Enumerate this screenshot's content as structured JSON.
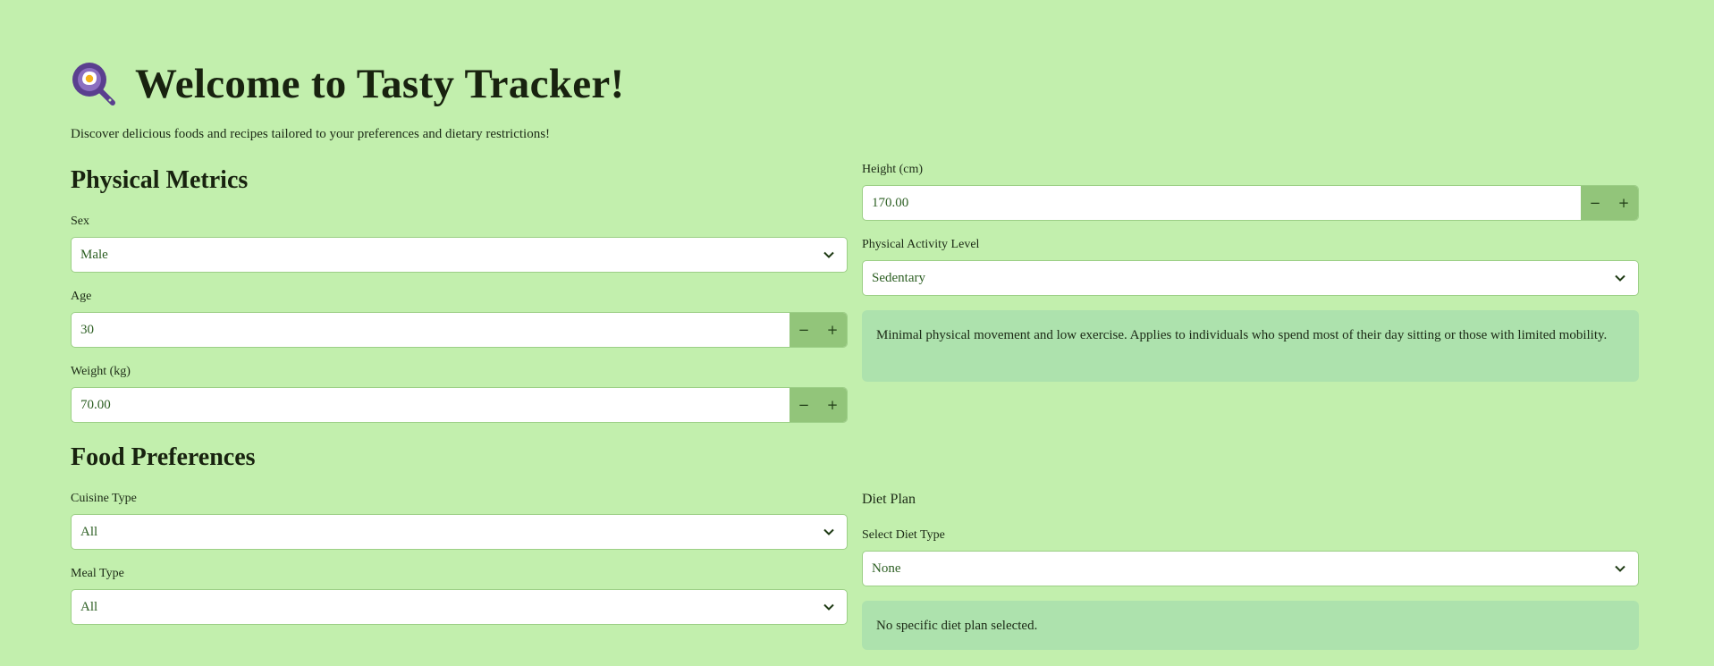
{
  "header": {
    "title": "Welcome to Tasty Tracker!",
    "subtitle": "Discover delicious foods and recipes tailored to your preferences and dietary restrictions!",
    "logo_icon": "frying-pan-egg-icon"
  },
  "physical_metrics": {
    "heading": "Physical Metrics",
    "sex": {
      "label": "Sex",
      "value": "Male"
    },
    "age": {
      "label": "Age",
      "value": "30"
    },
    "weight": {
      "label": "Weight (kg)",
      "value": "70.00"
    },
    "height": {
      "label": "Height (cm)",
      "value": "170.00"
    },
    "activity": {
      "label": "Physical Activity Level",
      "value": "Sedentary",
      "description": "Minimal physical movement and low exercise. Applies to individuals who spend most of their day sitting or those with limited mobility."
    }
  },
  "food_preferences": {
    "heading": "Food Preferences",
    "cuisine": {
      "label": "Cuisine Type",
      "value": "All"
    },
    "meal": {
      "label": "Meal Type",
      "value": "All"
    },
    "diet_plan": {
      "heading": "Diet Plan",
      "label": "Select Diet Type",
      "value": "None",
      "description": "No specific diet plan selected."
    }
  },
  "stepper": {
    "minus": "−",
    "plus": "+"
  },
  "colors": {
    "background": "#c2efad",
    "stepper_button": "#92c57a",
    "info_box": "#ade2ad",
    "logo": "#5a3f8f"
  }
}
